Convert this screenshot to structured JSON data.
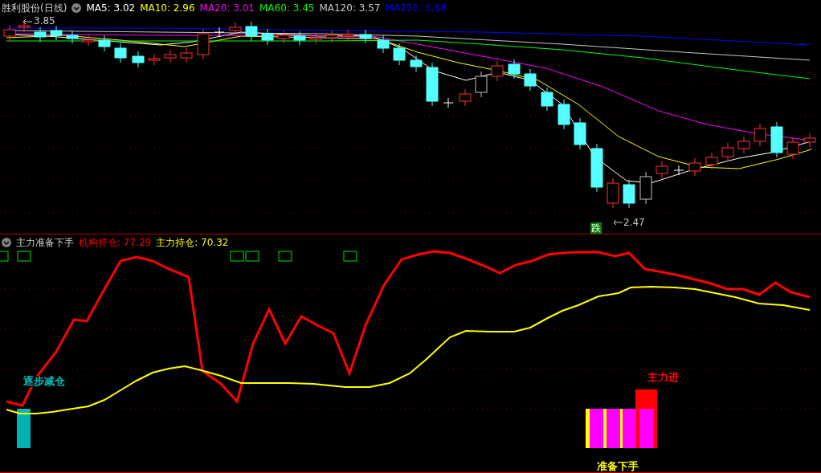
{
  "main_chart": {
    "title": "胜利股份(日线)",
    "indicators": [
      {
        "label": "MA5: 3.02",
        "color": "#ffffff"
      },
      {
        "label": "MA10: 2.96",
        "color": "#ffff00"
      },
      {
        "label": "MA20: 3.01",
        "color": "#ff00ff"
      },
      {
        "label": "MA60: 3.45",
        "color": "#00ff00"
      },
      {
        "label": "MA120: 3.57",
        "color": "#c8c8c8"
      },
      {
        "label": "MA250: 3.68",
        "color": "#0000ff"
      }
    ],
    "high_label": "3.85",
    "low_label": "2.47",
    "signal_badge": "跌"
  },
  "sub_chart": {
    "title": "主力准备下手",
    "indicators": [
      {
        "label": "机构持仓: 77.29",
        "color": "#ff0000"
      },
      {
        "label": "主力持仓: 70.32",
        "color": "#ffff00"
      }
    ],
    "annotations": [
      {
        "text": "逐步减仓",
        "color": "#00c0c0"
      },
      {
        "text": "主力进",
        "color": "#ff0000"
      },
      {
        "text": "准备下手",
        "color": "#ffff00"
      }
    ]
  }
}
